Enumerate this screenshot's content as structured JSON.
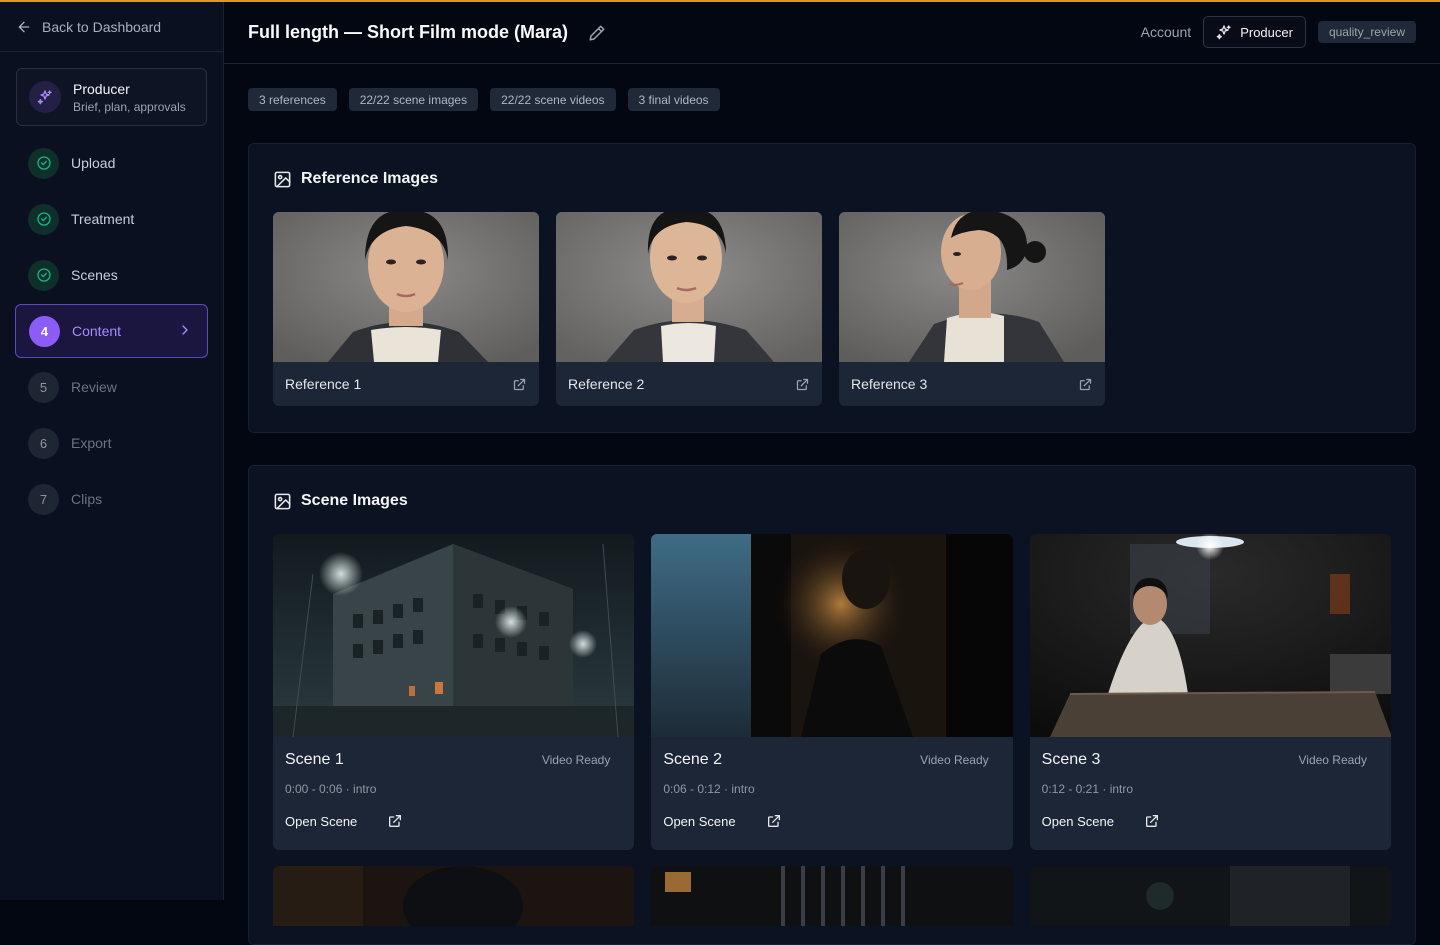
{
  "sidebar": {
    "back_label": "Back to Dashboard",
    "producer": {
      "title": "Producer",
      "subtitle": "Brief, plan, approvals"
    },
    "steps": [
      {
        "label": "Upload",
        "state": "done"
      },
      {
        "label": "Treatment",
        "state": "done"
      },
      {
        "label": "Scenes",
        "state": "done"
      },
      {
        "number": "4",
        "label": "Content",
        "state": "active"
      },
      {
        "number": "5",
        "label": "Review",
        "state": "todo"
      },
      {
        "number": "6",
        "label": "Export",
        "state": "todo"
      },
      {
        "number": "7",
        "label": "Clips",
        "state": "todo"
      }
    ]
  },
  "header": {
    "title": "Full length — Short Film mode (Mara)",
    "account_label": "Account",
    "producer_button": "Producer",
    "role_badge": "quality_review"
  },
  "chips": [
    "3 references",
    "22/22 scene images",
    "22/22 scene videos",
    "3 final videos"
  ],
  "reference_section": {
    "title": "Reference Images",
    "items": [
      {
        "label": "Reference 1"
      },
      {
        "label": "Reference 2"
      },
      {
        "label": "Reference 3"
      }
    ]
  },
  "scene_section": {
    "title": "Scene Images",
    "open_label": "Open Scene",
    "items": [
      {
        "name": "Scene 1",
        "status": "Video Ready",
        "time": "0:00 - 0:06 · intro"
      },
      {
        "name": "Scene 2",
        "status": "Video Ready",
        "time": "0:06 - 0:12 · intro"
      },
      {
        "name": "Scene 3",
        "status": "Video Ready",
        "time": "0:12 - 0:21 · intro"
      }
    ]
  },
  "colors": {
    "accent": "#8b5cf6",
    "background": "#030712",
    "card": "#1c2637",
    "done": "#10b981",
    "top_bar": "#d89a2b"
  }
}
